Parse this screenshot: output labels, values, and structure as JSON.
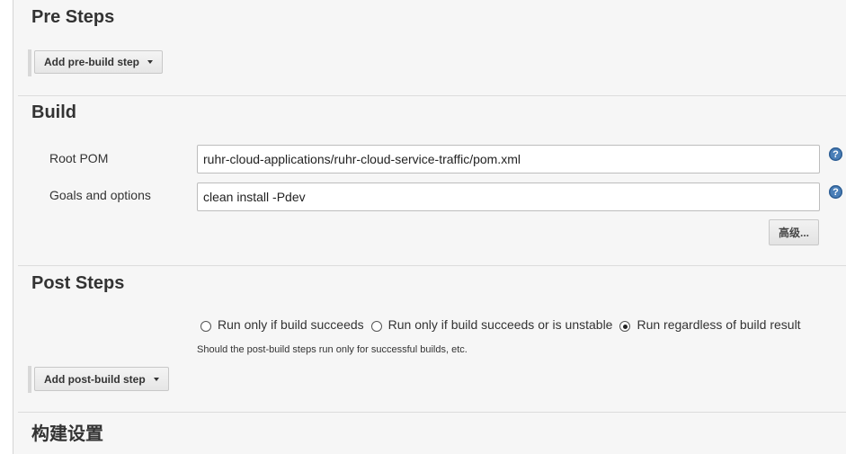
{
  "pre_steps": {
    "title": "Pre Steps",
    "add_button_label": "Add pre-build step"
  },
  "build": {
    "title": "Build",
    "root_pom": {
      "label": "Root POM",
      "value": "ruhr-cloud-applications/ruhr-cloud-service-traffic/pom.xml"
    },
    "goals": {
      "label": "Goals and options",
      "value": "clean install -Pdev"
    },
    "help_glyph": "?",
    "advanced_label": "高级..."
  },
  "post_steps": {
    "title": "Post Steps",
    "options": [
      {
        "label": "Run only if build succeeds",
        "selected": false
      },
      {
        "label": "Run only if build succeeds or is unstable",
        "selected": false
      },
      {
        "label": "Run regardless of build result",
        "selected": true
      }
    ],
    "hint": "Should the post-build steps run only for successful builds, etc.",
    "add_button_label": "Add post-build step"
  },
  "build_settings": {
    "title": "构建设置"
  }
}
